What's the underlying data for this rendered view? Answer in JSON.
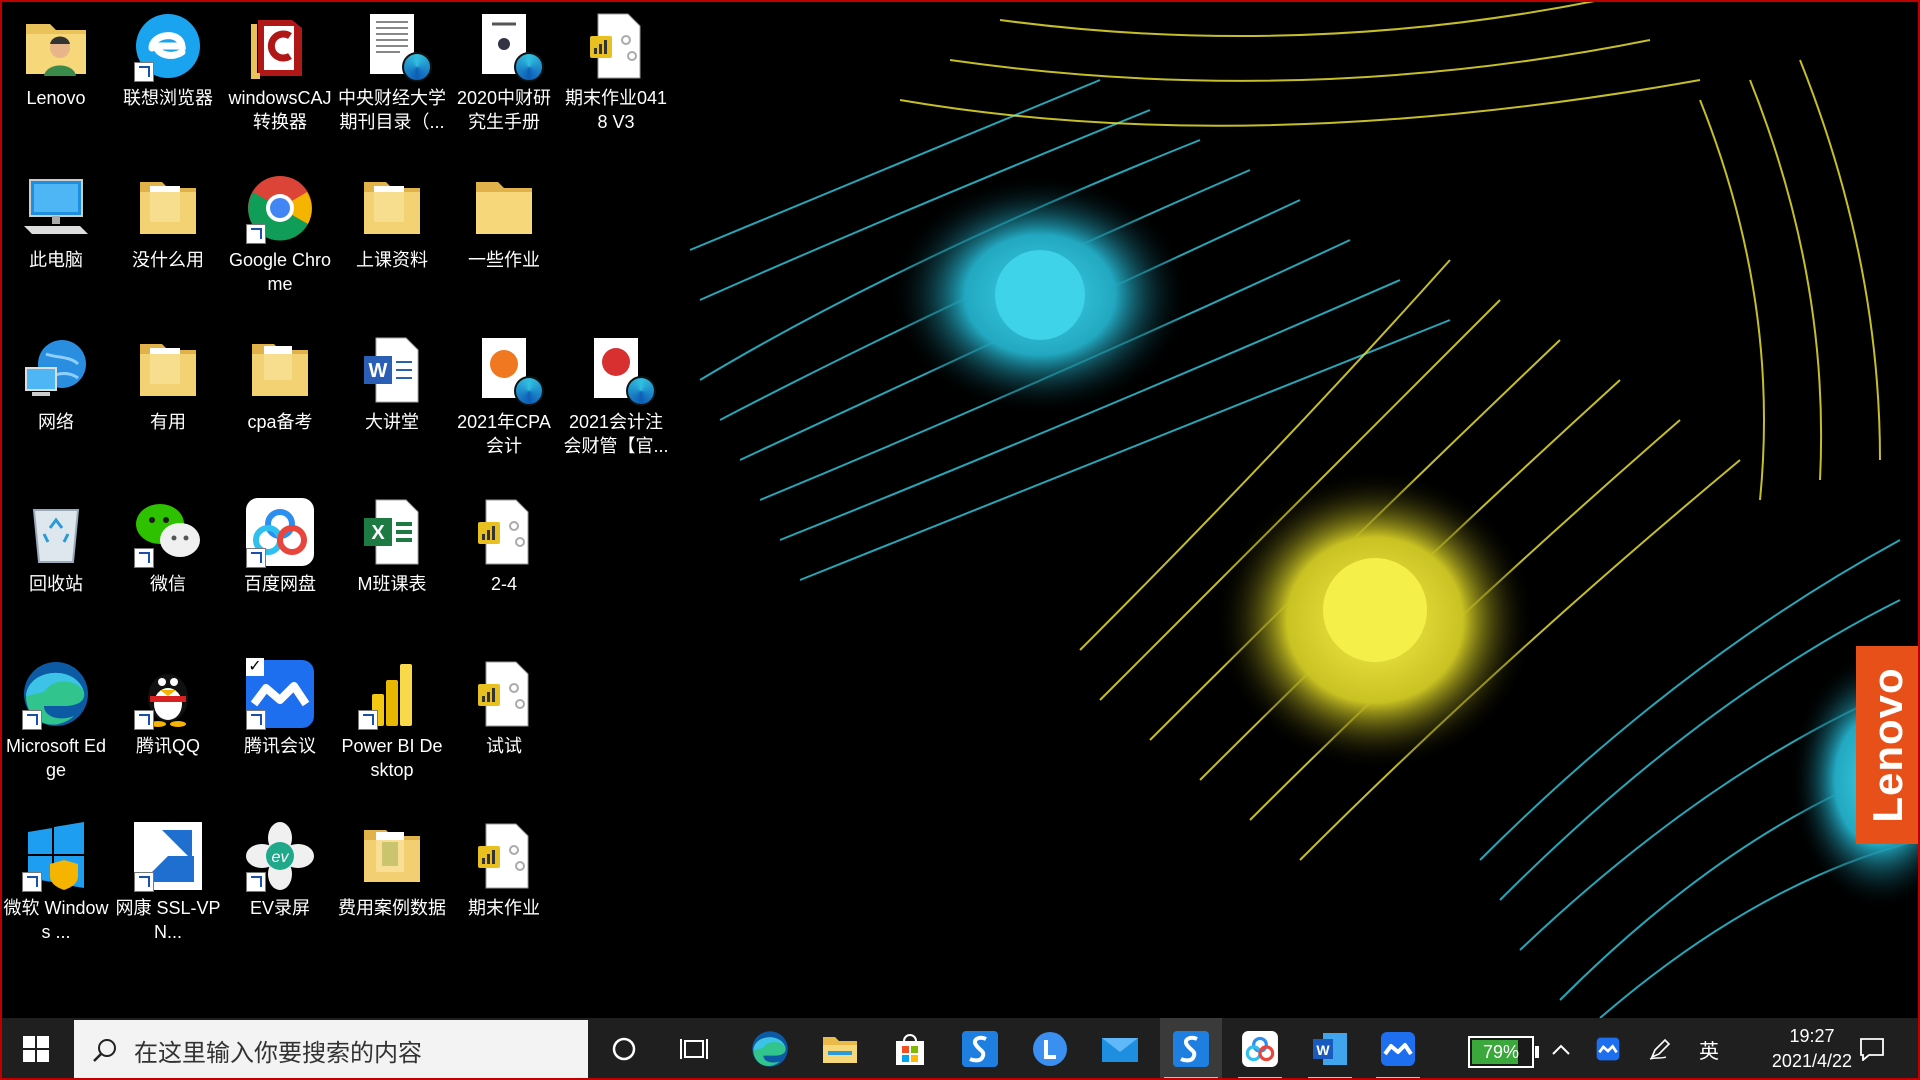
{
  "desktop": {
    "icons": [
      {
        "label": "Lenovo"
      },
      {
        "label": "联想浏览器"
      },
      {
        "label": "windowsCAJ转换器"
      },
      {
        "label": "中央财经大学期刊目录（..."
      },
      {
        "label": "2020中财研究生手册"
      },
      {
        "label": "期末作业0418 V3"
      },
      {
        "label": "此电脑"
      },
      {
        "label": "没什么用"
      },
      {
        "label": "Google Chrome"
      },
      {
        "label": "上课资料"
      },
      {
        "label": "一些作业"
      },
      {
        "label": "网络"
      },
      {
        "label": "有用"
      },
      {
        "label": "cpa备考"
      },
      {
        "label": "大讲堂"
      },
      {
        "label": "2021年CPA会计"
      },
      {
        "label": "2021会计注会财管【官..."
      },
      {
        "label": "回收站"
      },
      {
        "label": "微信"
      },
      {
        "label": "百度网盘"
      },
      {
        "label": "M班课表"
      },
      {
        "label": "2-4"
      },
      {
        "label": "Microsoft Edge"
      },
      {
        "label": "腾讯QQ"
      },
      {
        "label": "腾讯会议"
      },
      {
        "label": "Power BI Desktop"
      },
      {
        "label": "试试"
      },
      {
        "label": "微软 Windows ..."
      },
      {
        "label": "网康 SSL-VPN..."
      },
      {
        "label": "EV录屏"
      },
      {
        "label": "费用案例数据"
      },
      {
        "label": "期末作业"
      }
    ]
  },
  "wallpaper": {
    "brand": "Lenovo"
  },
  "taskbar": {
    "search_placeholder": "在这里输入你要搜索的内容",
    "pinned": [
      "start-icon",
      "cortana-icon",
      "task-view-icon",
      "edge-icon",
      "file-explorer-icon",
      "store-icon",
      "sangfor-icon",
      "lenovo-l-icon",
      "mail-icon",
      "sangfor-active-icon",
      "baidu-netdisk-icon",
      "word-icon",
      "tencent-meeting-icon"
    ],
    "battery_percent": "79%",
    "battery_level": 0.79,
    "ime": "英",
    "time": "19:27",
    "date": "2021/4/22"
  },
  "colors": {
    "feather_cyan": "#2fc4d8",
    "feather_yellow": "#e8e030",
    "lenovo_orange": "#e8501a",
    "taskbar": "#1f1f1f"
  }
}
